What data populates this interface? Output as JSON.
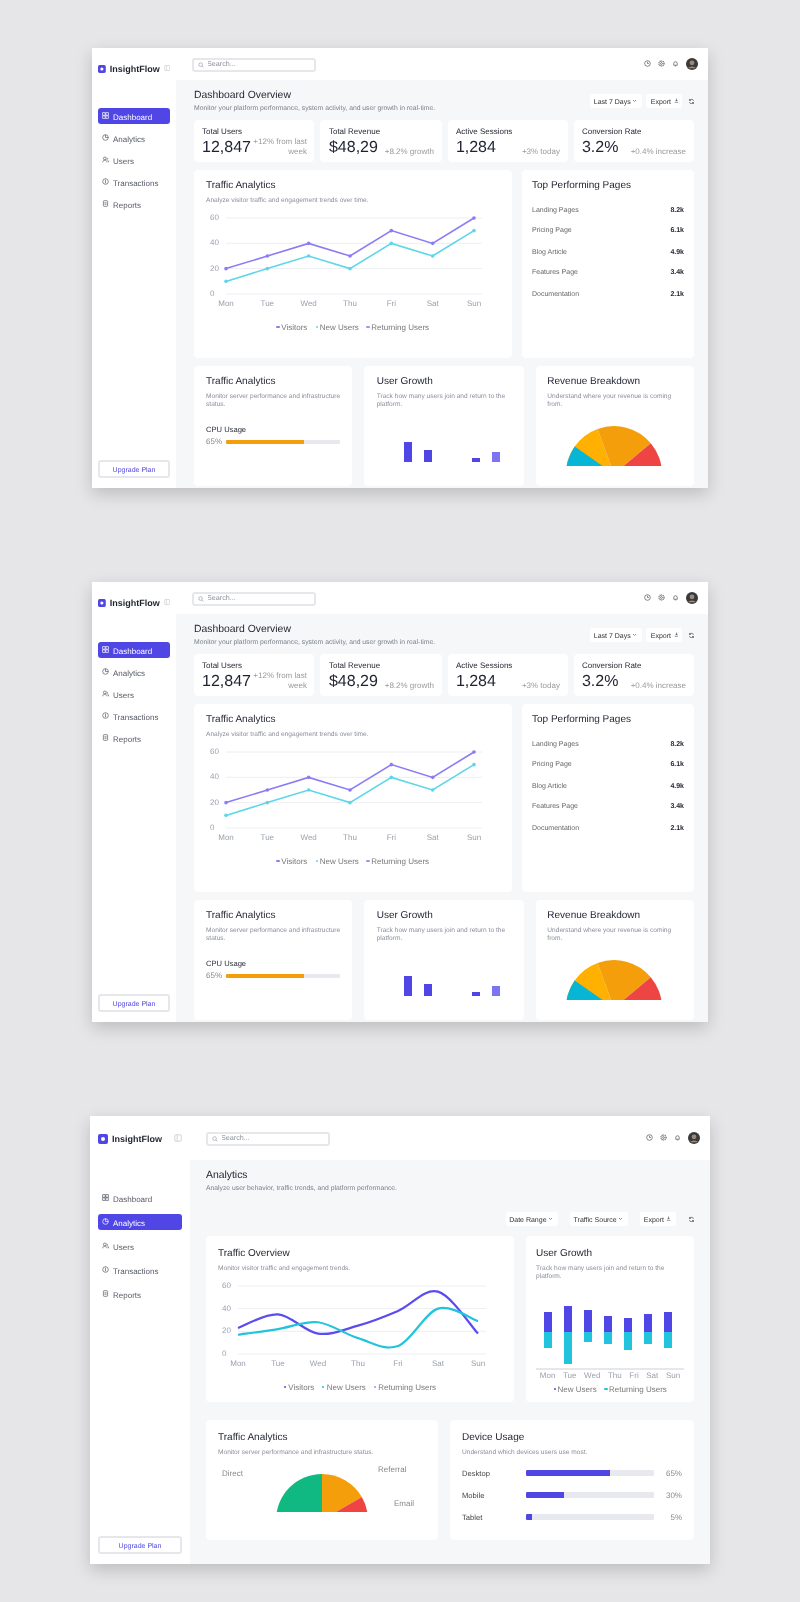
{
  "screens": [
    {
      "kind": "overview",
      "brand": "InsightFlow",
      "search": {
        "placeholder": "Search..."
      },
      "nav": [
        {
          "label": "Dashboard",
          "selected": true
        },
        {
          "label": "Analytics",
          "selected": false
        },
        {
          "label": "Users",
          "selected": false
        },
        {
          "label": "Transactions",
          "selected": false
        },
        {
          "label": "Reports",
          "selected": false
        }
      ],
      "upgrade": "Upgrade Plan",
      "title": "Dashboard Overview",
      "subtitle": "Monitor your platform performance, system activity, and user growth in real-time.",
      "actions": [
        {
          "label": "Last 7 Days",
          "kind": "dropdown"
        },
        {
          "label": "Export",
          "kind": "export"
        }
      ],
      "stats": [
        {
          "label": "Total Users",
          "value": "12,847",
          "note": "+12% from last week"
        },
        {
          "label": "Total Revenue",
          "value": "$48,29",
          "note": "+8.2% growth"
        },
        {
          "label": "Active Sessions",
          "value": "1,284",
          "note": "+3% today"
        },
        {
          "label": "Conversion Rate",
          "value": "3.2%",
          "note": "+0.4% increase"
        }
      ],
      "traffic": {
        "title": "Traffic Analytics",
        "subtitle": "Analyze visitor traffic and engagement trends over time.",
        "chart_data": {
          "type": "line",
          "legend": "bottom",
          "categories": [
            "Mon",
            "Tue",
            "Wed",
            "Thu",
            "Fri",
            "Sat",
            "Sun"
          ],
          "ylim": [
            0,
            60
          ],
          "yticks": [
            0,
            20,
            40,
            60
          ],
          "series": [
            {
              "name": "Visitors",
              "color": "#8b7cf6",
              "values": [
                20,
                30,
                40,
                30,
                50,
                40,
                60
              ]
            },
            {
              "name": "New Users",
              "color": "#5dd6ea",
              "values": [
                10,
                20,
                30,
                20,
                40,
                30,
                50
              ]
            },
            {
              "name": "Returning Users",
              "color": "#a78bfa",
              "values": [
                null,
                null,
                null,
                null,
                null,
                null,
                null
              ]
            }
          ]
        }
      },
      "top_pages": {
        "title": "Top Performing Pages",
        "rows": [
          {
            "name": "Landing Pages",
            "value": "8.2k"
          },
          {
            "name": "Pricing Page",
            "value": "6.1k"
          },
          {
            "name": "Blog Article",
            "value": "4.9k"
          },
          {
            "name": "Features Page",
            "value": "3.4k"
          },
          {
            "name": "Documentation",
            "value": "2.1k"
          }
        ]
      },
      "lower": [
        {
          "kind": "meter",
          "title": "Traffic Analytics",
          "subtitle": "Monitor server performance and infrastructure status.",
          "meter": {
            "label": "CPU Usage",
            "reading": "65%",
            "level": 0.68
          }
        },
        {
          "kind": "bars",
          "title": "User Growth",
          "subtitle": "Track how many users join and return to the platform."
        },
        {
          "kind": "pie",
          "title": "Revenue Breakdown",
          "subtitle": "Understand where your revenue is coming from."
        }
      ]
    },
    {
      "kind": "overview",
      "brand": "InsightFlow",
      "search": {
        "placeholder": "Search..."
      },
      "nav": [
        {
          "label": "Dashboard",
          "selected": true
        },
        {
          "label": "Analytics",
          "selected": false
        },
        {
          "label": "Users",
          "selected": false
        },
        {
          "label": "Transactions",
          "selected": false
        },
        {
          "label": "Reports",
          "selected": false
        }
      ],
      "upgrade": "Upgrade Plan",
      "title": "Dashboard Overview",
      "subtitle": "Monitor your platform performance, system activity, and user growth in real-time.",
      "actions": [
        {
          "label": "Last 7 Days",
          "kind": "dropdown"
        },
        {
          "label": "Export",
          "kind": "export"
        }
      ],
      "stats": [
        {
          "label": "Total Users",
          "value": "12,847",
          "note": "+12% from last week"
        },
        {
          "label": "Total Revenue",
          "value": "$48,29",
          "note": "+8.2% growth"
        },
        {
          "label": "Active Sessions",
          "value": "1,284",
          "note": "+3% today"
        },
        {
          "label": "Conversion Rate",
          "value": "3.2%",
          "note": "+0.4% increase"
        }
      ],
      "traffic": {
        "title": "Traffic Analytics",
        "subtitle": "Analyze visitor traffic and engagement trends over time.",
        "chart_data": {
          "type": "line",
          "legend": "bottom",
          "categories": [
            "Mon",
            "Tue",
            "Wed",
            "Thu",
            "Fri",
            "Sat",
            "Sun"
          ],
          "ylim": [
            0,
            60
          ],
          "yticks": [
            0,
            20,
            40,
            60
          ],
          "series": [
            {
              "name": "Visitors",
              "color": "#8b7cf6",
              "values": [
                20,
                30,
                40,
                30,
                50,
                40,
                60
              ]
            },
            {
              "name": "New Users",
              "color": "#5dd6ea",
              "values": [
                10,
                20,
                30,
                20,
                40,
                30,
                50
              ]
            },
            {
              "name": "Returning Users",
              "color": "#a78bfa",
              "values": [
                null,
                null,
                null,
                null,
                null,
                null,
                null
              ]
            }
          ]
        }
      },
      "top_pages": {
        "title": "Top Performing Pages",
        "rows": [
          {
            "name": "Landing Pages",
            "value": "8.2k"
          },
          {
            "name": "Pricing Page",
            "value": "6.1k"
          },
          {
            "name": "Blog Article",
            "value": "4.9k"
          },
          {
            "name": "Features Page",
            "value": "3.4k"
          },
          {
            "name": "Documentation",
            "value": "2.1k"
          }
        ]
      },
      "lower": [
        {
          "kind": "meter",
          "title": "Traffic Analytics",
          "subtitle": "Monitor server performance and infrastructure status.",
          "meter": {
            "label": "CPU Usage",
            "reading": "65%",
            "level": 0.68
          }
        },
        {
          "kind": "bars",
          "title": "User Growth",
          "subtitle": "Track how many users join and return to the platform."
        },
        {
          "kind": "pie",
          "title": "Revenue Breakdown",
          "subtitle": "Understand where your revenue is coming from."
        }
      ]
    },
    {
      "kind": "analytics",
      "brand": "InsightFlow",
      "search": {
        "placeholder": "Search..."
      },
      "nav": [
        {
          "label": "Dashboard",
          "selected": false
        },
        {
          "label": "Analytics",
          "selected": true
        },
        {
          "label": "Users",
          "selected": false
        },
        {
          "label": "Transactions",
          "selected": false
        },
        {
          "label": "Reports",
          "selected": false
        }
      ],
      "upgrade": "Upgrade Plan",
      "title": "Analytics",
      "subtitle": "Analyze user behavior, traffic trends, and platform performance.",
      "actions": [
        {
          "label": "Date Range",
          "kind": "dropdown"
        },
        {
          "label": "Traffic Source",
          "kind": "dropdown"
        },
        {
          "label": "Export",
          "kind": "export"
        }
      ],
      "overview": {
        "title": "Traffic Overview",
        "subtitle": "Monitor visitor traffic and engagement trends.",
        "chart_data": {
          "type": "line",
          "legend": "bottom",
          "categories": [
            "Mon",
            "Tue",
            "Wed",
            "Thu",
            "Fri",
            "Sat",
            "Sun"
          ],
          "ylim": [
            0,
            60
          ],
          "yticks": [
            0,
            20,
            40,
            60
          ],
          "series": [
            {
              "name": "Visitors",
              "color": "#5b4cf0",
              "values": [
                23,
                35,
                18,
                25,
                38,
                55,
                18
              ]
            },
            {
              "name": "New Users",
              "color": "#22c3dc",
              "values": [
                17,
                22,
                28,
                14,
                7,
                40,
                29
              ]
            },
            {
              "name": "Returning Users",
              "color": "#a78bfa",
              "values": [
                null,
                null,
                null,
                null,
                null,
                null,
                null
              ]
            }
          ]
        }
      },
      "growth": {
        "title": "User Growth",
        "subtitle": "Track how many users join and return to the platform.",
        "x_labels": [
          "Mon",
          "Tue",
          "Wed",
          "Thu",
          "Fri",
          "Sat",
          "Sun"
        ],
        "legend": [
          "New Users",
          "Returning Users"
        ]
      },
      "sources": {
        "title": "Traffic Analytics",
        "subtitle": "Monitor server performance and infrastructure status.",
        "labels": [
          "Direct",
          "Referral",
          "Email"
        ]
      },
      "devices": {
        "title": "Device Usage",
        "subtitle": "Understand which devices users use most.",
        "rows": [
          {
            "name": "Desktop",
            "reading": "65%",
            "level": 0.65
          },
          {
            "name": "Mobile",
            "reading": "30%",
            "level": 0.3
          },
          {
            "name": "Tablet",
            "reading": "5%",
            "level": 0.05
          }
        ]
      }
    }
  ]
}
